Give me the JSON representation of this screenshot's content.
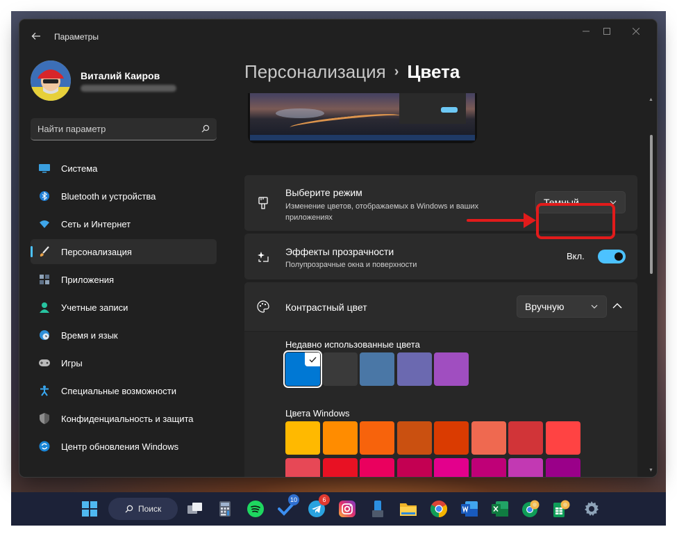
{
  "window": {
    "app_title": "Параметры"
  },
  "user": {
    "name": "Виталий Каиров"
  },
  "search": {
    "placeholder": "Найти параметр"
  },
  "sidebar": {
    "items": [
      {
        "label": "Система",
        "icon": "system-icon"
      },
      {
        "label": "Bluetooth и устройства",
        "icon": "bluetooth-icon"
      },
      {
        "label": "Сеть и Интернет",
        "icon": "wifi-icon"
      },
      {
        "label": "Персонализация",
        "icon": "brush-icon",
        "active": true
      },
      {
        "label": "Приложения",
        "icon": "apps-icon"
      },
      {
        "label": "Учетные записи",
        "icon": "person-icon"
      },
      {
        "label": "Время и язык",
        "icon": "globe-clock-icon"
      },
      {
        "label": "Игры",
        "icon": "gamepad-icon"
      },
      {
        "label": "Специальные возможности",
        "icon": "accessibility-icon"
      },
      {
        "label": "Конфиденциальность и защита",
        "icon": "shield-icon"
      },
      {
        "label": "Центр обновления Windows",
        "icon": "update-icon"
      }
    ]
  },
  "breadcrumb": {
    "parent": "Персонализация",
    "separator": "›",
    "current": "Цвета"
  },
  "mode_card": {
    "title": "Выберите режим",
    "description": "Изменение цветов, отображаемых в Windows и ваших приложениях",
    "value": "Темный"
  },
  "transparency_card": {
    "title": "Эффекты прозрачности",
    "description": "Полупрозрачные окна и поверхности",
    "toggle_label": "Вкл.",
    "toggle_on": true
  },
  "accent_card": {
    "title": "Контрастный цвет",
    "value": "Вручную",
    "recent_label": "Недавно использованные цвета",
    "recent_colors": [
      "#0078d4",
      "#3a3a3a",
      "#4a77a6",
      "#6b69b0",
      "#a04ec0"
    ],
    "windows_label": "Цвета Windows",
    "windows_colors_row1": [
      "#ffb900",
      "#ff8c00",
      "#f7630c",
      "#ca5010",
      "#da3b01",
      "#ef6950",
      "#d13438",
      "#ff4343"
    ],
    "windows_colors_row2": [
      "#e74856",
      "#e81123",
      "#ea005e",
      "#c30052",
      "#e3008c",
      "#bf0077",
      "#c239b3",
      "#9a0089"
    ]
  },
  "taskbar": {
    "search_label": "Поиск",
    "todo_badge": "10",
    "telegram_badge": "6"
  },
  "colors": {
    "accent": "#4cc2ff",
    "annotation": "#e21b1b",
    "window_bg": "#202020",
    "card_bg": "#2b2b2b"
  }
}
